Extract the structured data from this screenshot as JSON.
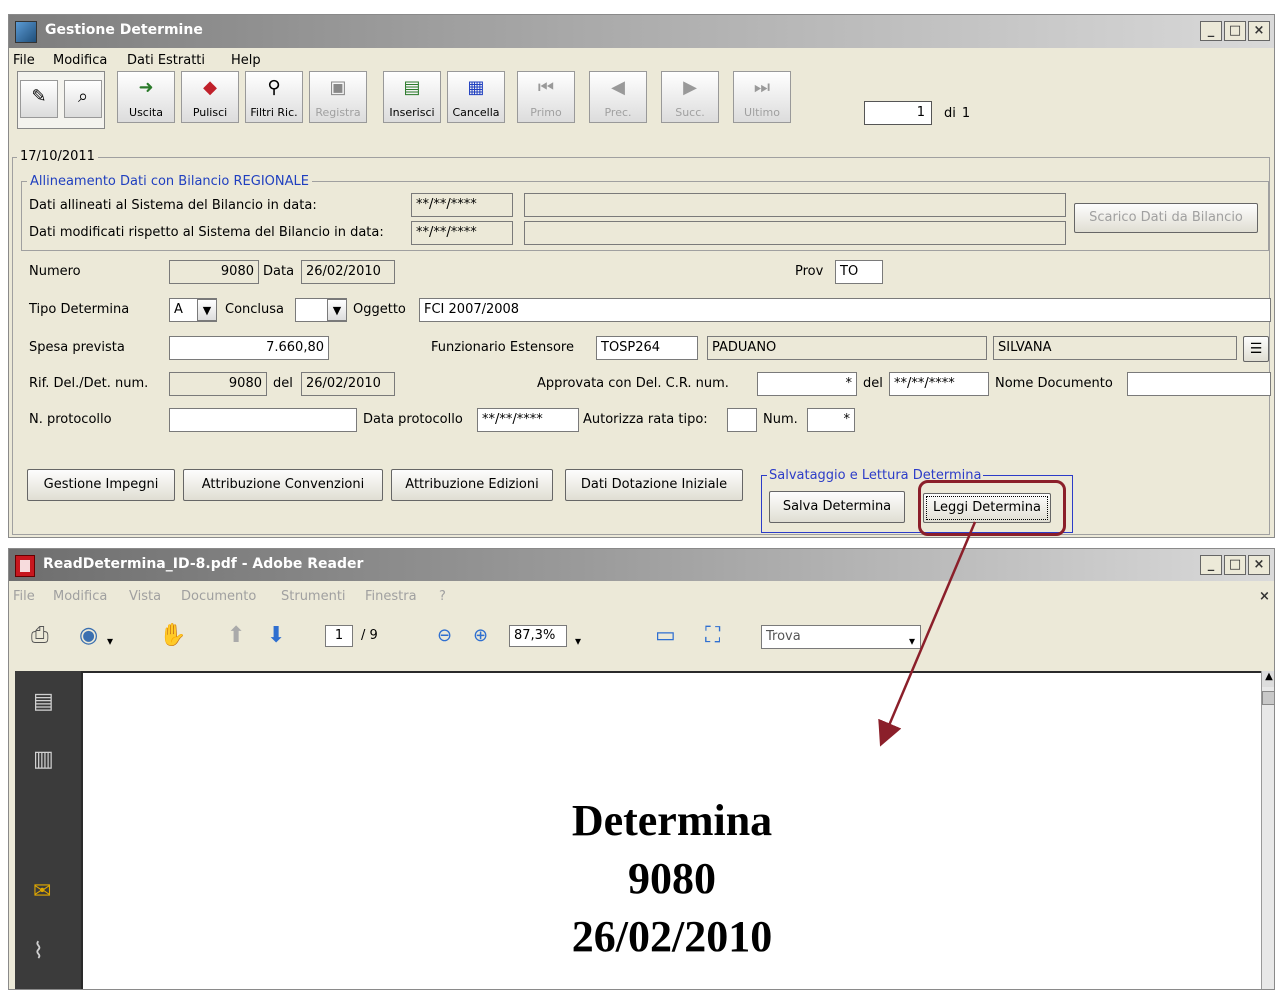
{
  "main_window": {
    "title": "Gestione Determine",
    "window_buttons": [
      "_",
      "□",
      "×"
    ],
    "menu": [
      "File",
      "Modifica",
      "Dati Estratti",
      "Help"
    ],
    "toolbar": {
      "uscita": "Uscita",
      "pulisci": "Pulisci",
      "filtri": "Filtri Ric.",
      "registra": "Registra",
      "inserisci": "Inserisci",
      "cancella": "Cancella",
      "primo": "Primo",
      "prec": "Prec.",
      "succ": "Succ.",
      "ultimo": "Ultimo"
    },
    "pager": {
      "current": "1",
      "of_label": "di",
      "total": "1"
    },
    "date": "17/10/2011",
    "allineamento": {
      "legend": "Allineamento Dati con Bilancio REGIONALE",
      "row1_label": "Dati allineati al Sistema del Bilancio in data:",
      "row1_value": "**/**/****",
      "row2_label": "Dati modificati rispetto al Sistema del Bilancio in data:",
      "row2_value": "**/**/****",
      "scarico_button": "Scarico Dati da Bilancio"
    },
    "form": {
      "numero_label": "Numero",
      "numero_value": "9080",
      "data_label": "Data",
      "data_value": "26/02/2010",
      "prov_label": "Prov",
      "prov_value": "TO",
      "tipo_label": "Tipo Determina",
      "tipo_value": "A",
      "conclusa_label": "Conclusa",
      "conclusa_value": "",
      "oggetto_label": "Oggetto",
      "oggetto_value": "FCI 2007/2008",
      "spesa_label": "Spesa prevista",
      "spesa_value": "7.660,80",
      "funzionario_label": "Funzionario Estensore",
      "funzionario_code": "TOSP264",
      "funzionario_cognome": "PADUANO",
      "funzionario_nome": "SILVANA",
      "rif_label": "Rif. Del./Det. num.",
      "rif_value": "9080",
      "del_label": "del",
      "rif_date": "26/02/2010",
      "approvata_label": "Approvata con Del. C.R. num.",
      "approvata_value": "*",
      "del2_label": "del",
      "approvata_date": "**/**/****",
      "nome_doc_label": "Nome Documento",
      "nome_doc_value": "",
      "protocollo_label": "N. protocollo",
      "protocollo_value": "",
      "data_protocollo_label": "Data protocollo",
      "data_protocollo_value": "**/**/****",
      "autorizza_label": "Autorizza rata tipo:",
      "autorizza_value": "",
      "num_label": "Num.",
      "num_value": "*"
    },
    "buttons": {
      "impegni": "Gestione Impegni",
      "convenzioni": "Attribuzione Convenzioni",
      "edizioni": "Attribuzione Edizioni",
      "dotazione": "Dati Dotazione Iniziale",
      "salvataggio_legend": "Salvataggio e Lettura Determina",
      "salva": "Salva Determina",
      "leggi": "Leggi Determina"
    }
  },
  "reader_window": {
    "title": "ReadDetermina_ID-8.pdf - Adobe Reader",
    "window_buttons": [
      "_",
      "□",
      "×"
    ],
    "menu": [
      "File",
      "Modifica",
      "Vista",
      "Documento",
      "Strumenti",
      "Finestra",
      "?"
    ],
    "page_current": "1",
    "page_total": "/ 9",
    "zoom": "87,3%",
    "find_placeholder": "Trova",
    "document_lines": [
      "Determina",
      "9080",
      "26/02/2010"
    ]
  },
  "colors": {
    "window_bg": "#ece9d8",
    "legend_blue": "#1f3fbf",
    "frame_blue": "#2c3cc8",
    "highlight": "#8b1f2a",
    "annotation_arrow": "#8b1f2a"
  }
}
